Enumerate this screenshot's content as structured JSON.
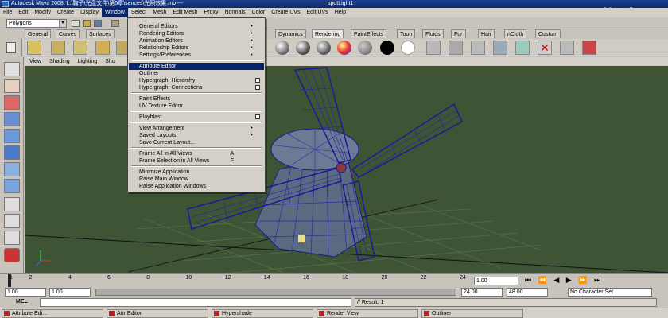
{
  "window": {
    "title": "Autodesk Maya 2008: L:\\鞠子\\光盘文件\\第5章\\sences\\光照效果.mb  ---",
    "object": "spotLight1"
  },
  "menubar": [
    "File",
    "Edit",
    "Modify",
    "Create",
    "Display",
    "Window",
    "Select",
    "Mesh",
    "Edit Mesh",
    "Proxy",
    "Normals",
    "Color",
    "Create UVs",
    "Edit UVs",
    "Help"
  ],
  "mode": "Polygons",
  "shelf_tabs": [
    "General",
    "Curves",
    "Surfaces",
    "Dynamics",
    "Rendering",
    "PaintEffects",
    "Toon",
    "Fluids",
    "Fur",
    "Hair",
    "nCloth",
    "Custom"
  ],
  "panel_menu": [
    "View",
    "Shading",
    "Lighting",
    "Sho"
  ],
  "window_menu": {
    "items": [
      {
        "label": "General Editors",
        "sub": "▸"
      },
      {
        "label": "Rendering Editors",
        "sub": "▸"
      },
      {
        "label": "Animation Editors",
        "sub": "▸"
      },
      {
        "label": "Relationship Editors",
        "sub": "▸"
      },
      {
        "label": "Settings/Preferences",
        "sub": "▸"
      },
      {
        "label": "Attribute Editor",
        "highlight": true
      },
      {
        "label": "Outliner"
      },
      {
        "label": "Hypergraph: Hierarchy",
        "opt": true
      },
      {
        "label": "Hypergraph: Connections",
        "opt": true
      },
      {
        "label": "Paint Effects"
      },
      {
        "label": "UV Texture Editor"
      },
      {
        "label": "Playblast",
        "opt": true
      },
      {
        "label": "View Arrangement",
        "sub": "▸"
      },
      {
        "label": "Saved Layouts",
        "sub": "▸"
      },
      {
        "label": "Save Current Layout..."
      },
      {
        "label": "Frame All in All Views",
        "key": "A"
      },
      {
        "label": "Frame Selection in All Views",
        "key": "F"
      },
      {
        "label": "Minimize Application"
      },
      {
        "label": "Raise Main Window"
      },
      {
        "label": "Raise Application Windows"
      }
    ]
  },
  "timeline": {
    "ticks": [
      "1",
      "2",
      "4",
      "6",
      "8",
      "10",
      "12",
      "14",
      "16",
      "18",
      "20",
      "22",
      "24"
    ],
    "current_frame": "1.00"
  },
  "range": {
    "start": "1.00",
    "start2": "1.00",
    "end": "24.00",
    "end2": "48.00",
    "character_set": "No Character Set"
  },
  "command": {
    "label": "MEL",
    "result": "// Result: 1"
  },
  "taskbar": [
    {
      "label": "Attribute Edi..."
    },
    {
      "label": "Attr Editor"
    },
    {
      "label": "Hypershade"
    },
    {
      "label": "Render View"
    },
    {
      "label": "Outliner"
    }
  ],
  "watermark": "优酷",
  "colors": {
    "viewport_bg": "#3f5335",
    "menu_highlight": "#0a246a",
    "wireframe": "#1a1a88"
  }
}
